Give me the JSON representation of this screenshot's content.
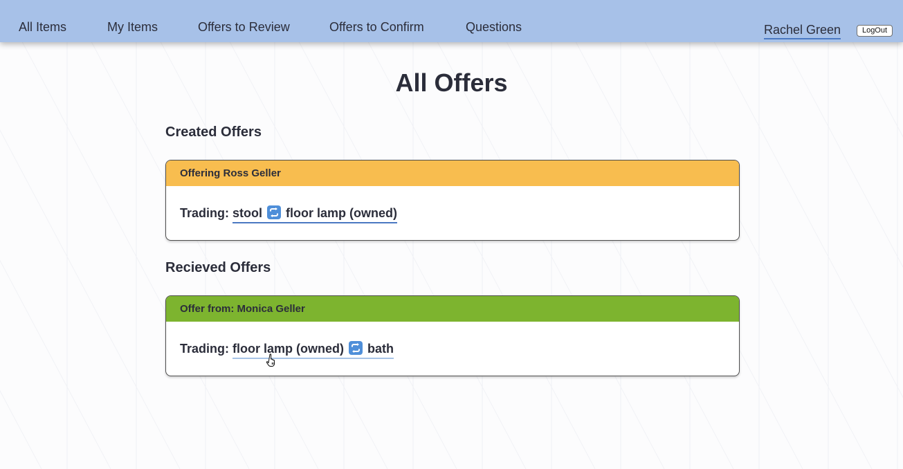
{
  "nav": {
    "links": [
      {
        "label": "All Items"
      },
      {
        "label": "My Items"
      },
      {
        "label": "Offers to Review"
      },
      {
        "label": "Offers to Confirm"
      },
      {
        "label": "Questions"
      }
    ],
    "user": "Rachel Green",
    "logout_label": "LogOut"
  },
  "page": {
    "title": "All Offers"
  },
  "created": {
    "title": "Created Offers",
    "offers": [
      {
        "header": "Offering Ross Geller",
        "trading_label": "Trading:",
        "give": "stool",
        "get": "floor lamp (owned)",
        "header_color": "#f8bd4f",
        "swap_icon": "swap-arrows-icon"
      }
    ]
  },
  "received": {
    "title": "Recieved Offers",
    "offers": [
      {
        "header": "Offer from: Monica Geller",
        "trading_label": "Trading:",
        "give": "floor lamp (owned)",
        "get": "bath",
        "header_color": "#7db42f",
        "swap_icon": "swap-arrows-icon"
      }
    ]
  },
  "colors": {
    "navbar": "#a7c1e8",
    "link_underline": "#4a78c2",
    "swap_icon_bg": "#4f8fd9"
  }
}
